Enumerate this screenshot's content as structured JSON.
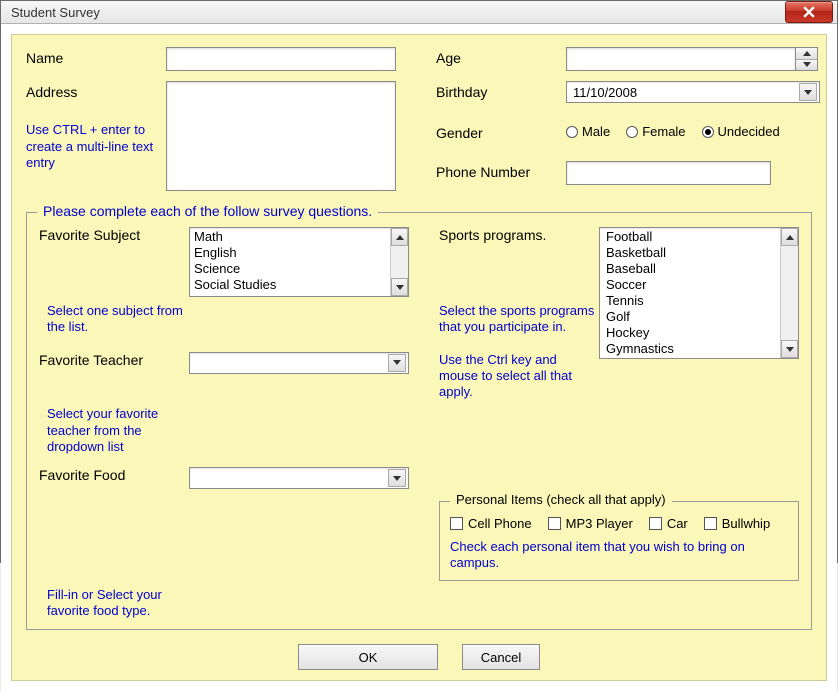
{
  "window": {
    "title": "Student Survey"
  },
  "top": {
    "name_label": "Name",
    "address_label": "Address",
    "address_hint": "Use CTRL + enter to create a multi-line text entry",
    "age_label": "Age",
    "birthday_label": "Birthday",
    "birthday_value": "11/10/2008",
    "gender_label": "Gender",
    "gender_options": {
      "male": "Male",
      "female": "Female",
      "undecided": "Undecided"
    },
    "gender_selected": "undecided",
    "phone_label": "Phone Number"
  },
  "survey": {
    "legend": "Please complete each of the follow survey questions.",
    "fav_subject_label": "Favorite Subject",
    "fav_subject_hint": "Select one subject from the list.",
    "subjects": [
      "Math",
      "English",
      "Science",
      "Social Studies"
    ],
    "fav_teacher_label": "Favorite Teacher",
    "fav_teacher_hint": "Select your favorite teacher from the dropdown list",
    "fav_food_label": "Favorite Food",
    "fav_food_hint": "Fill-in or Select your favorite food type.",
    "sports_label": "Sports programs.",
    "sports_hint1": "Select the sports programs that you participate in.",
    "sports_hint2": "Use the Ctrl key and mouse to select all that apply.",
    "sports": [
      "Football",
      "Basketball",
      "Baseball",
      "Soccer",
      "Tennis",
      "Golf",
      "Hockey",
      "Gymnastics"
    ],
    "personal_legend": "Personal Items (check all that apply)",
    "personal_items": {
      "cell": "Cell Phone",
      "mp3": "MP3 Player",
      "car": "Car",
      "bullwhip": "Bullwhip"
    },
    "personal_hint": "Check each personal item that you wish to bring on campus."
  },
  "buttons": {
    "ok": "OK",
    "cancel": "Cancel"
  }
}
